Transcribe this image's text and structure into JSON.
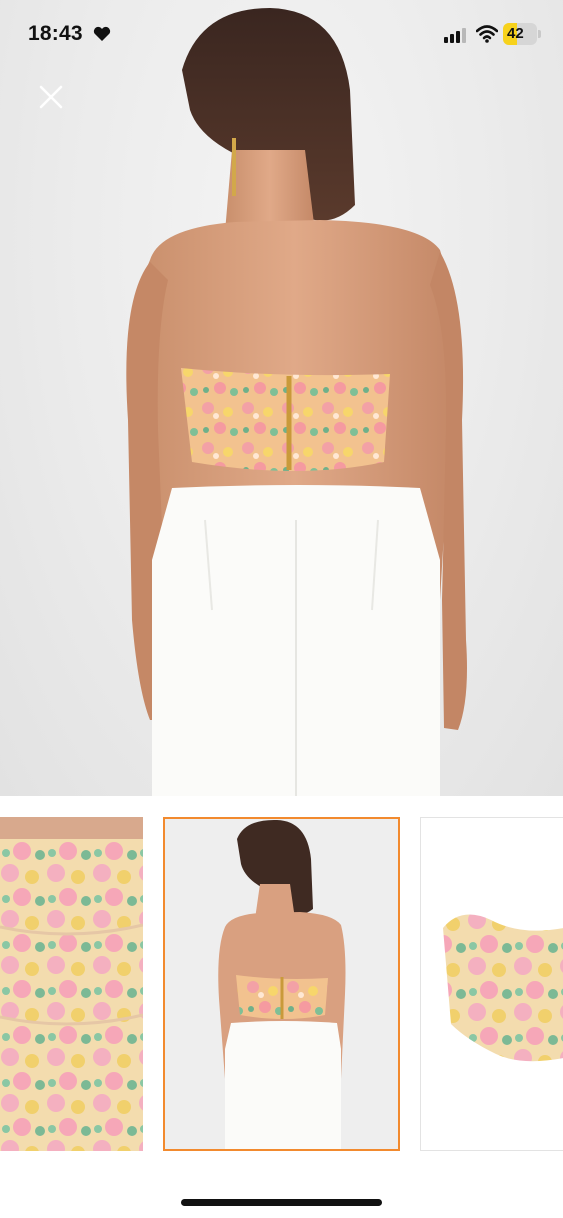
{
  "status_bar": {
    "time": "18:43",
    "heart_icon": "heart-icon",
    "signal_icon": "cellular-signal-icon",
    "wifi_icon": "wifi-icon",
    "battery_level": "42",
    "battery_fraction": 0.42
  },
  "gallery": {
    "close_icon": "close-icon",
    "main_image": "model-back-view-floral-bandeau-top",
    "thumbnails": [
      {
        "name": "fabric-closeup"
      },
      {
        "name": "model-back-view",
        "selected": true
      },
      {
        "name": "product-flat-view"
      }
    ]
  },
  "colors": {
    "selected_border": "#f28a2e",
    "background": "#ffffff"
  }
}
